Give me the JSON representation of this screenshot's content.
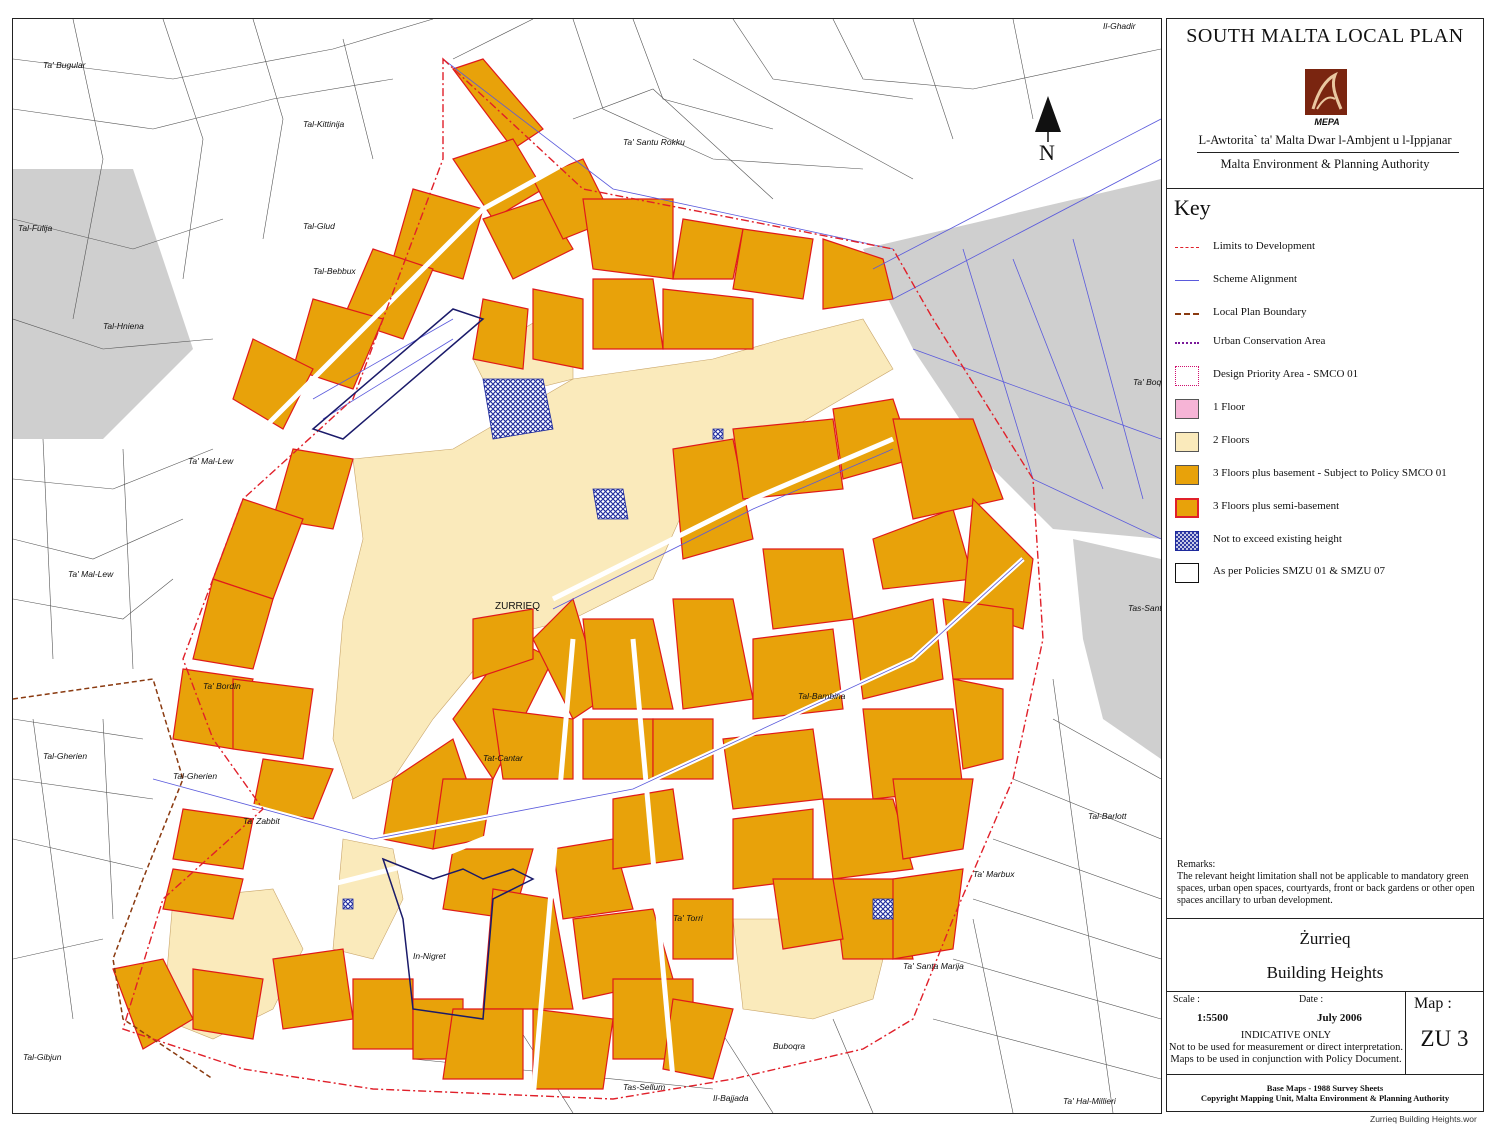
{
  "header": {
    "plan_title": "SOUTH MALTA LOCAL PLAN",
    "logo_text": "MEPA",
    "authority_maltese": "L-Awtorita` ta' Malta Dwar l-Ambjent u l-Ippjanar",
    "authority_english": "Malta Environment & Planning Authority"
  },
  "key": {
    "title": "Key",
    "items": [
      {
        "label": "Limits to Development",
        "symbol": "line-dashdot",
        "color": "#e0202a"
      },
      {
        "label": "Scheme Alignment",
        "symbol": "line-solid",
        "color": "#5a5adc"
      },
      {
        "label": "Local Plan Boundary",
        "symbol": "line-dashed",
        "color": "#8a3a10"
      },
      {
        "label": "Urban Conservation Area",
        "symbol": "line-dotted",
        "color": "#7a1a9a"
      },
      {
        "label": "Design Priority Area - SMCO 01",
        "symbol": "box-dotted",
        "color": "#d01070"
      },
      {
        "label": "1 Floor",
        "symbol": "fill",
        "color": "#f6b4d6"
      },
      {
        "label": "2 Floors",
        "symbol": "fill",
        "color": "#faeabb"
      },
      {
        "label": "3 Floors plus basement - Subject to Policy SMCO 01",
        "symbol": "fill",
        "color": "#e8a20a"
      },
      {
        "label": "3 Floors plus semi-basement",
        "symbol": "fill-red-border",
        "color": "#e8a20a"
      },
      {
        "label": "Not to exceed existing height",
        "symbol": "hatch",
        "color": "#1e2a9c"
      },
      {
        "label": "As per Policies SMZU 01 & SMZU 07",
        "symbol": "box-outline",
        "color": "#111111"
      }
    ]
  },
  "remarks": {
    "heading": "Remarks:",
    "text": "The relevant height limitation shall not be applicable to mandatory green spaces, urban open spaces, courtyards, front or back gardens or other open spaces ancillary to urban development."
  },
  "map_info": {
    "town": "Żurrieq",
    "subject": "Building Heights",
    "scale_label": "Scale :",
    "scale_value": "1:5500",
    "date_label": "Date :",
    "date_value": "July 2006",
    "indicative_line1": "INDICATIVE ONLY",
    "indicative_line2": "Not to be used for measurement or direct interpretation.",
    "indicative_line3": "Maps to be used in conjunction with Policy Document.",
    "map_label": "Map :",
    "map_number": "ZU 3"
  },
  "source": {
    "line1": "Base Maps - 1988 Survey Sheets",
    "line2": "Copyright Mapping Unit, Malta Environment & Planning Authority"
  },
  "footer": {
    "filename": "Zurrieq Building Heights.wor"
  },
  "map": {
    "north_label": "N",
    "town_label": "ZURRIEQ",
    "place_names": [
      "Ta' Bugular",
      "Tal-Kittinija",
      "Ta' Santu Rokku",
      "Il-Ghadir",
      "Tal-Glud",
      "Tal-Fulija",
      "Tal-Bebbux",
      "Tal-Hniena",
      "Ta' Mal-Lew",
      "Ta' Mal-Lew",
      "Ta' Bordin",
      "Ta' Boqajjet",
      "Tas-Sant' Aga",
      "Tal-Gherien",
      "Tal-Gherien",
      "Tal-Barlott",
      "Tat-Cantar",
      "Tal-Bambina",
      "Ta' Marbux",
      "Ta' Santa Marija",
      "In-Nigret",
      "Ta' Torri",
      "Buboqra",
      "Il-Bajjada",
      "Tas-Sellum",
      "Tal-Gibjun",
      "Ta' Zabbit",
      "Ta' Hal-Millieri"
    ]
  }
}
